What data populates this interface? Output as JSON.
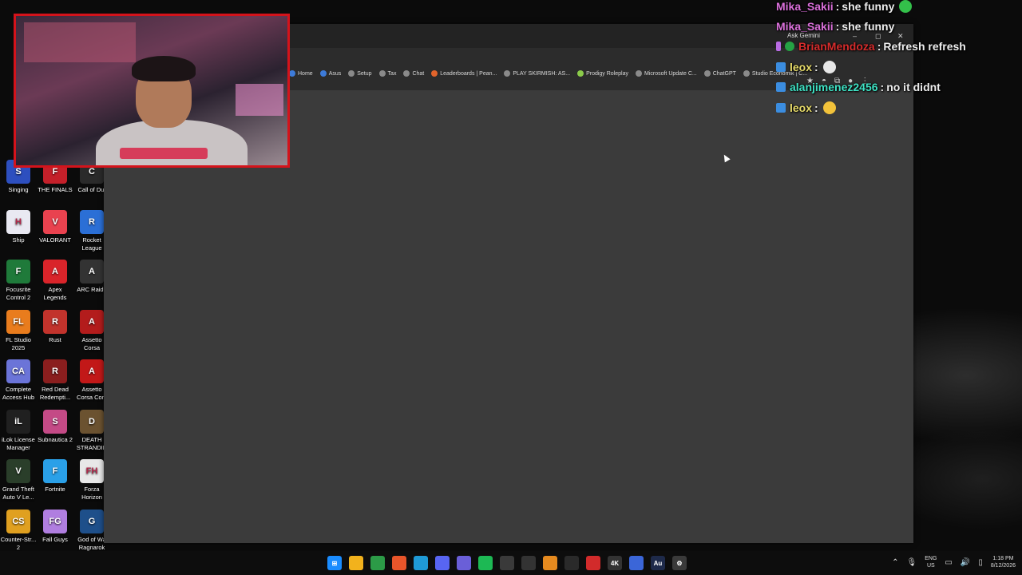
{
  "webcam": {
    "label": "streamer webcam"
  },
  "desktop_icons": [
    {
      "label": "Singing",
      "color": "#2d4fbf",
      "glyph": "S"
    },
    {
      "label": "THE FINALS",
      "color": "#c4202a",
      "glyph": "F"
    },
    {
      "label": "Call of Dut",
      "color": "#2a2a2a",
      "glyph": "C"
    },
    {
      "label": "Ship",
      "color": "#e9e9f2",
      "glyph": "H"
    },
    {
      "label": "VALORANT",
      "color": "#e9424f",
      "glyph": "V"
    },
    {
      "label": "Rocket League",
      "color": "#2b6fd6",
      "glyph": "R"
    },
    {
      "label": "Focusrite Control 2",
      "color": "#1f7a3a",
      "glyph": "F"
    },
    {
      "label": "Apex Legends",
      "color": "#d9242a",
      "glyph": "A"
    },
    {
      "label": "ARC Raide",
      "color": "#333",
      "glyph": "A"
    },
    {
      "label": "FL Studio 2025",
      "color": "#e97c1d",
      "glyph": "FL"
    },
    {
      "label": "Rust",
      "color": "#c2332c",
      "glyph": "R"
    },
    {
      "label": "Assetto Corsa",
      "color": "#b31c1c",
      "glyph": "A"
    },
    {
      "label": "Complete Access Hub",
      "color": "#6b74d8",
      "glyph": "CA"
    },
    {
      "label": "Red Dead Redempti...",
      "color": "#8a1e1e",
      "glyph": "R"
    },
    {
      "label": "Assetto Corsa Com",
      "color": "#c21818",
      "glyph": "A"
    },
    {
      "label": "iLok License Manager",
      "color": "#202020",
      "glyph": "iL"
    },
    {
      "label": "Subnautica 2",
      "color": "#c44a86",
      "glyph": "S"
    },
    {
      "label": "DEATH STRANDIN",
      "color": "#6b5230",
      "glyph": "D"
    },
    {
      "label": "Grand Theft Auto V Le...",
      "color": "#2a3e2a",
      "glyph": "V"
    },
    {
      "label": "Fortnite",
      "color": "#2aa0e8",
      "glyph": "F"
    },
    {
      "label": "Forza Horizon",
      "color": "#e8e8e8",
      "glyph": "FH"
    },
    {
      "label": "Counter-Str... 2",
      "color": "#e0a020",
      "glyph": "CS"
    },
    {
      "label": "Fall Guys",
      "color": "#b07ee0",
      "glyph": "FG"
    },
    {
      "label": "God of Wa Ragnarok",
      "color": "#1e4f8a",
      "glyph": "G"
    }
  ],
  "browser": {
    "ask_gemini": "Ask Gemini",
    "window_controls": {
      "minimize": "–",
      "maximize": "◻",
      "close": "✕"
    },
    "bookmarks": [
      {
        "label": "Home",
        "icon": "blue"
      },
      {
        "label": "Asus",
        "icon": "blue"
      },
      {
        "label": "Setup",
        "icon": "grey"
      },
      {
        "label": "Tax",
        "icon": "grey"
      },
      {
        "label": "Chat",
        "icon": "grey"
      },
      {
        "label": "Leaderboards | Pean...",
        "icon": "orange"
      },
      {
        "label": "PLAY SKIRMISH: AS...",
        "icon": "grey"
      },
      {
        "label": "Prodigy Roleplay",
        "icon": "green"
      },
      {
        "label": "Microsoft Update C...",
        "icon": "grey"
      },
      {
        "label": "ChatGPT",
        "icon": "grey"
      },
      {
        "label": "Studio Economik | C...",
        "icon": "grey"
      }
    ]
  },
  "chat": {
    "messages": [
      {
        "user": "Mika_Sakii",
        "text": "she funny",
        "user_color": "#d96fd9",
        "badge": "",
        "emote": "green"
      },
      {
        "user": "Mika_Sakii",
        "text": "she funny",
        "user_color": "#d96fd9",
        "badge": "",
        "emote": ""
      },
      {
        "user": "BrianMendoza",
        "text": "Refresh refresh",
        "user_color": "#d62c2c",
        "badge": "mic",
        "emote": ""
      },
      {
        "user": "leox",
        "text": "",
        "user_color": "#e8dc6a",
        "badge": "blue",
        "emote": "white"
      },
      {
        "user": "alanjimenez2456",
        "text": "no it didnt",
        "user_color": "#3ee2c4",
        "badge": "blue",
        "emote": ""
      },
      {
        "user": "leox",
        "text": "",
        "user_color": "#e8dc6a",
        "badge": "blue",
        "emote": "yellow"
      }
    ]
  },
  "taskbar": {
    "apps": [
      {
        "name": "start",
        "glyph": "⊞",
        "color": "#1a8cff"
      },
      {
        "name": "file-explorer",
        "glyph": "",
        "color": "#f2b21c"
      },
      {
        "name": "chrome",
        "glyph": "",
        "color": "#2c9b47"
      },
      {
        "name": "brave",
        "glyph": "",
        "color": "#e8552a"
      },
      {
        "name": "edge",
        "glyph": "",
        "color": "#1f9ad6"
      },
      {
        "name": "discord",
        "glyph": "",
        "color": "#5865f2"
      },
      {
        "name": "app-grid",
        "glyph": "",
        "color": "#6a5fd8"
      },
      {
        "name": "spotify",
        "glyph": "",
        "color": "#1db954"
      },
      {
        "name": "obs",
        "glyph": "",
        "color": "#3a3a3a"
      },
      {
        "name": "nvidia",
        "glyph": "",
        "color": "#333"
      },
      {
        "name": "folder",
        "glyph": "",
        "color": "#e58a1f"
      },
      {
        "name": "capture",
        "glyph": "",
        "color": "#2a2a2a"
      },
      {
        "name": "creative-cloud",
        "glyph": "",
        "color": "#d22b2b"
      },
      {
        "name": "4k",
        "glyph": "4K",
        "color": "#333"
      },
      {
        "name": "app-blue",
        "glyph": "",
        "color": "#3b66d8"
      },
      {
        "name": "audition",
        "glyph": "Au",
        "color": "#1e2a4a"
      },
      {
        "name": "settings",
        "glyph": "⚙",
        "color": "#3a3a3a"
      }
    ],
    "lang_top": "ENG",
    "lang_bottom": "US",
    "time": "1:18 PM",
    "date": "8/12/2026"
  }
}
